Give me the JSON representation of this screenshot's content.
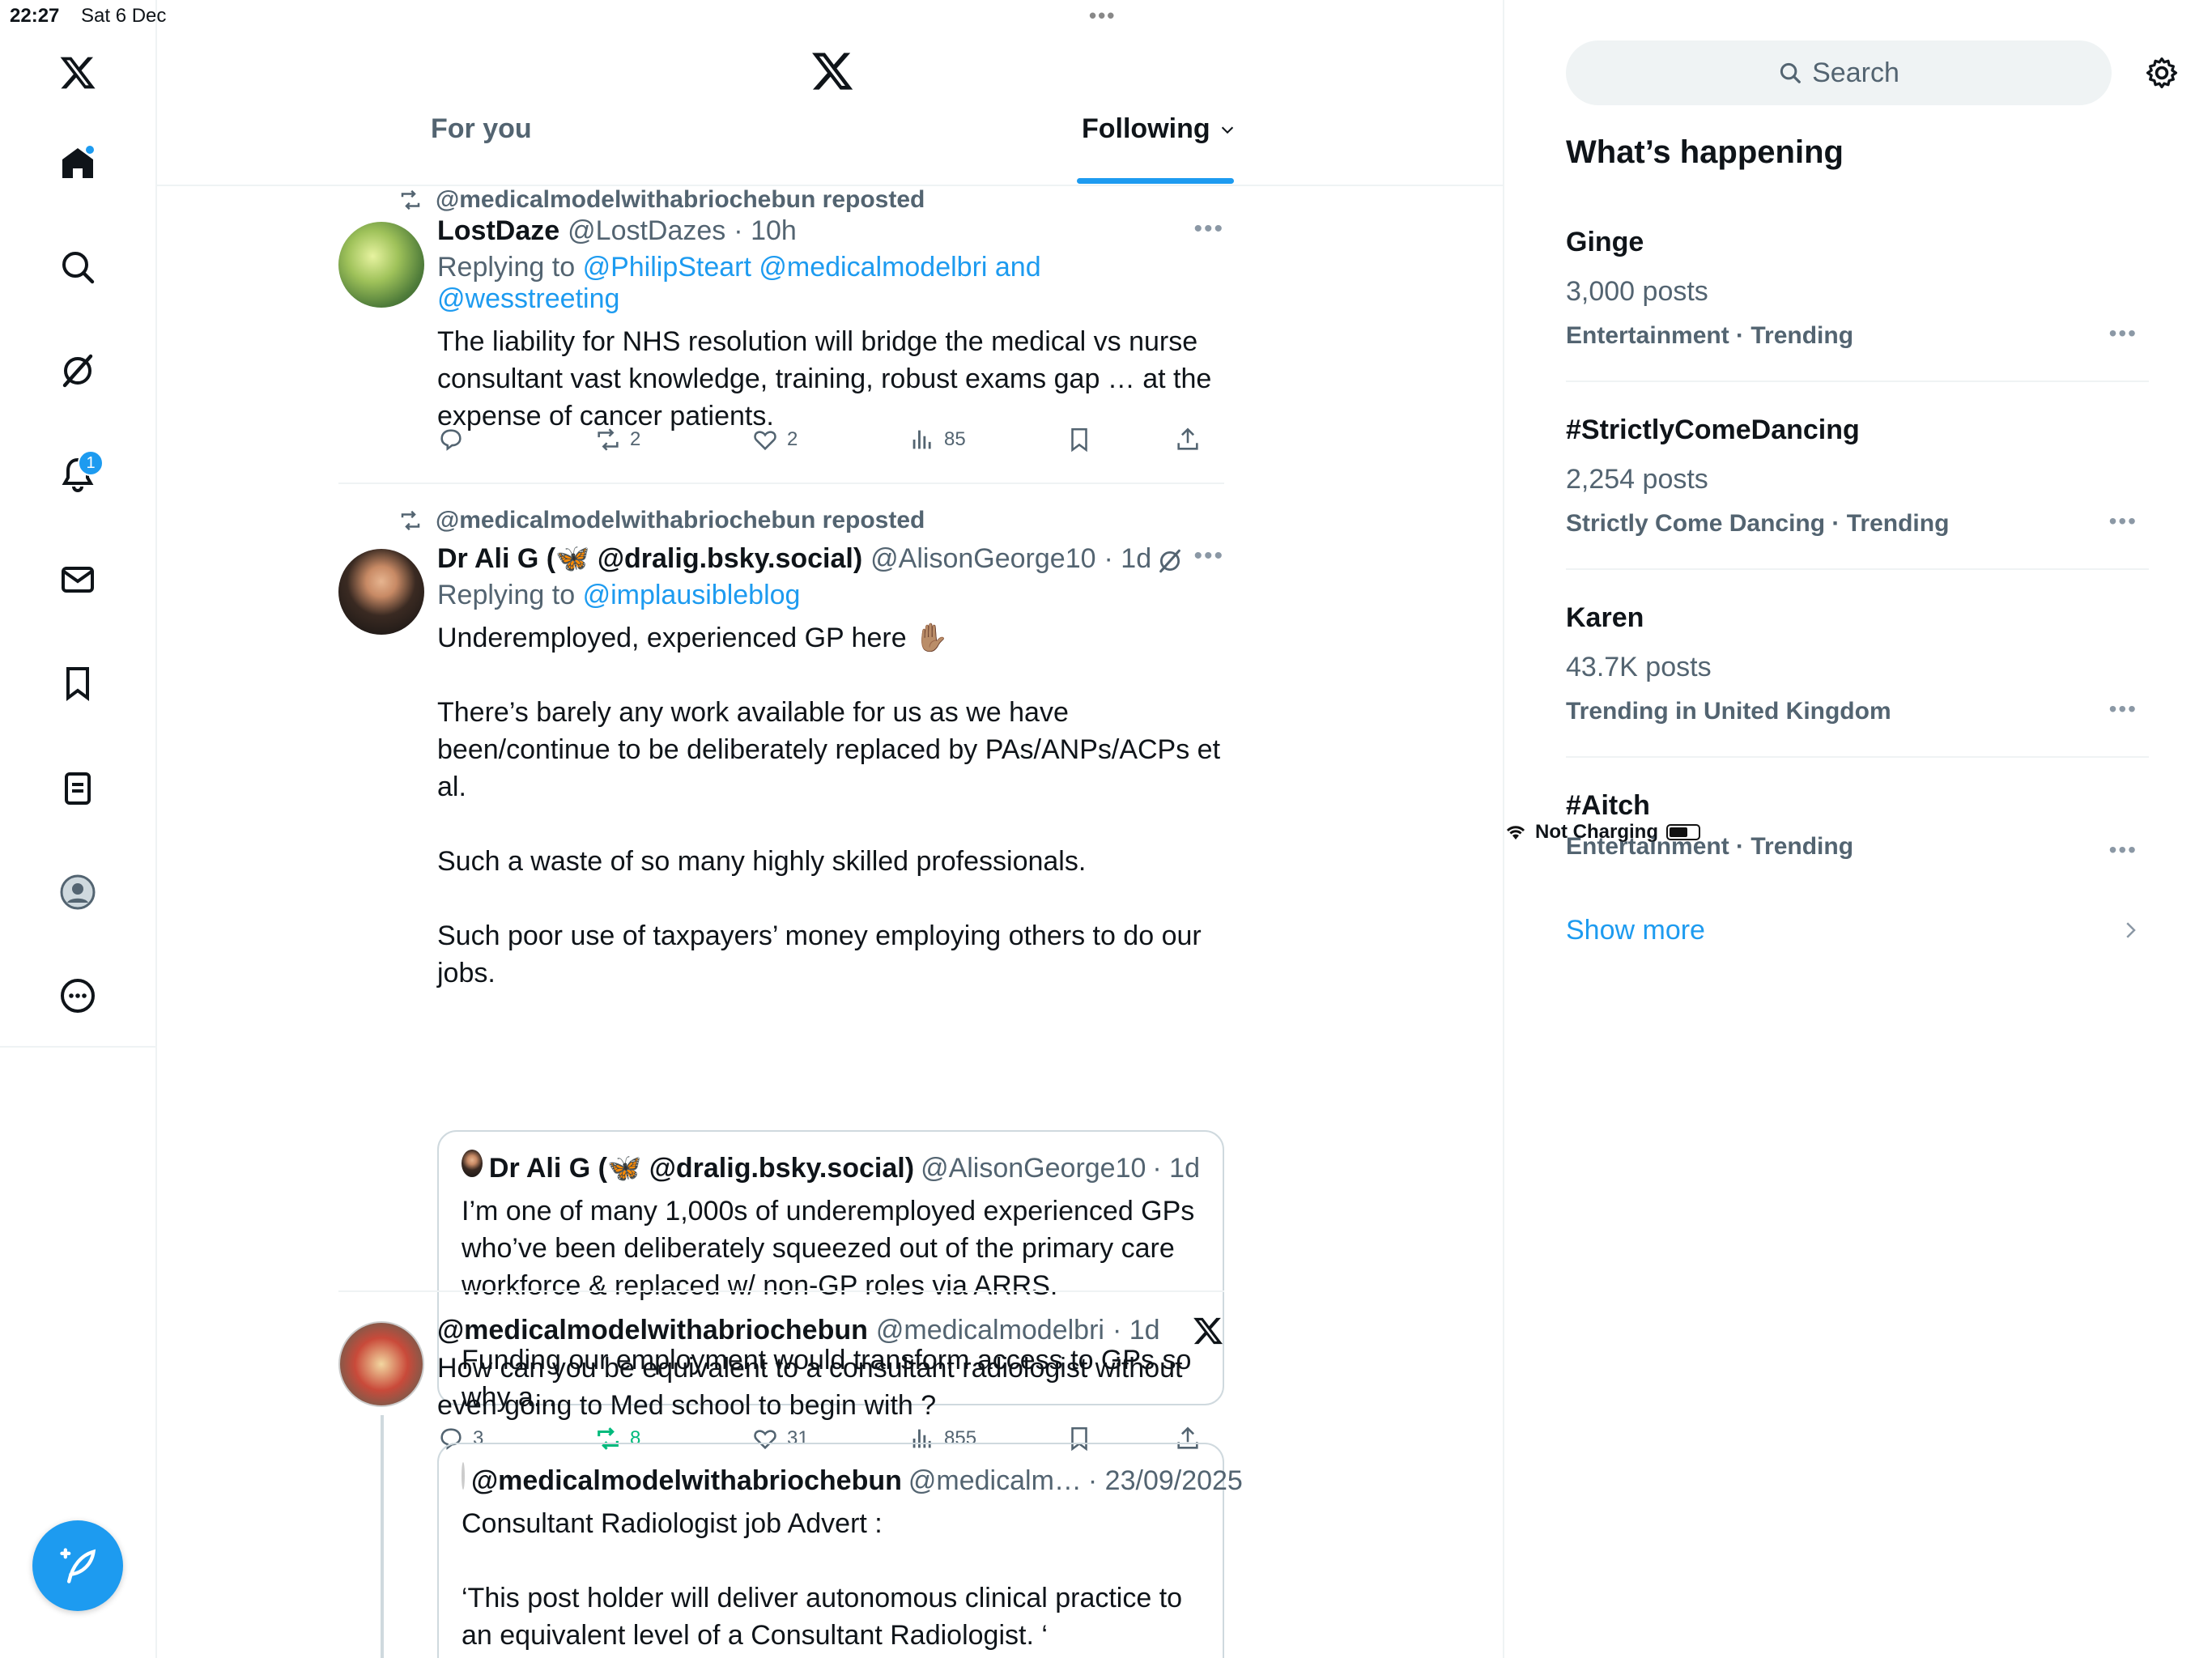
{
  "status_bar": {
    "time": "22:27",
    "date": "Sat 6 Dec",
    "charging": "Not Charging"
  },
  "tabs": {
    "for_you": "For you",
    "following": "Following"
  },
  "posts": [
    {
      "repost_label": "@medicalmodelwithabriochebun reposted",
      "name": "LostDaze",
      "handle": "@LostDazes",
      "time": "· 10h",
      "reply_prefix": "Replying to",
      "reply_to": "@PhilipSteart @medicalmodelbri and @wesstreeting",
      "text": "The liability for NHS resolution will bridge the medical vs nurse consultant vast knowledge, training, robust exams gap … at the expense of cancer patients.",
      "replies": "",
      "reposts": "2",
      "likes": "2",
      "views": "85"
    },
    {
      "repost_label": "@medicalmodelwithabriochebun reposted",
      "name": "Dr Ali G (🦋 @dralig.bsky.social)",
      "handle": "@AlisonGeorge10",
      "time": "· 1d",
      "reply_prefix": "Replying to",
      "reply_to": "@implausibleblog",
      "text": "Underemployed, experienced GP here ✋🏽\n\nThere’s barely any work available for us as we have been/continue to be deliberately replaced by PAs/ANPs/ACPs et al.\n\nSuch a waste of so many highly skilled professionals.\n\nSuch poor use of taxpayers’ money employing others to do our jobs.",
      "quote": {
        "name": "Dr Ali G (🦋 @dralig.bsky.social)",
        "handle": "@AlisonGeorge10",
        "time": "· 1d",
        "text": "I’m one of many 1,000s of underemployed experienced GPs who’ve been deliberately squeezed out of the primary care workforce & replaced w/ non-GP roles via ARRS.\n\nFunding our employment would transform access to GPs so why a..."
      },
      "replies": "3",
      "reposts": "8",
      "likes": "31",
      "views": "855"
    },
    {
      "name": "@medicalmodelwithabriochebun",
      "handle": "@medicalmodelbri",
      "time": "· 1d",
      "text": "How can you be equivalent to a consultant radiologist without even going to Med school to begin with ?",
      "quote": {
        "name": "@medicalmodelwithabriochebun",
        "handle": "@medicalm…",
        "time": "· 23/09/2025",
        "text": "Consultant Radiologist job Advert :\n\n ‘This post holder will deliver autonomous clinical practice to an equivalent level of a Consultant Radiologist. ‘"
      }
    }
  ],
  "sidebar": {
    "search_placeholder": "Search",
    "title": "What’s happening",
    "trends": [
      {
        "name": "Ginge",
        "count": "3,000 posts",
        "category": "Entertainment · Trending"
      },
      {
        "name": "#StrictlyComeDancing",
        "count": "2,254 posts",
        "category": "Strictly Come Dancing · Trending"
      },
      {
        "name": "Karen",
        "count": "43.7K posts",
        "category": "Trending in United Kingdom"
      },
      {
        "name": "#Aitch",
        "count": "",
        "category": "Entertainment · Trending"
      }
    ],
    "show_more": "Show more"
  },
  "nav": {
    "items": [
      "x-logo-icon",
      "home-icon",
      "search-icon",
      "grok-icon",
      "notifications-icon",
      "messages-icon",
      "bookmarks-icon",
      "lists-icon",
      "profile-icon",
      "more-icon"
    ],
    "notification_count": "1"
  },
  "colors": {
    "accent": "#1d9bf0",
    "repost_green": "#00ba7c",
    "secondary_text": "#536471"
  }
}
